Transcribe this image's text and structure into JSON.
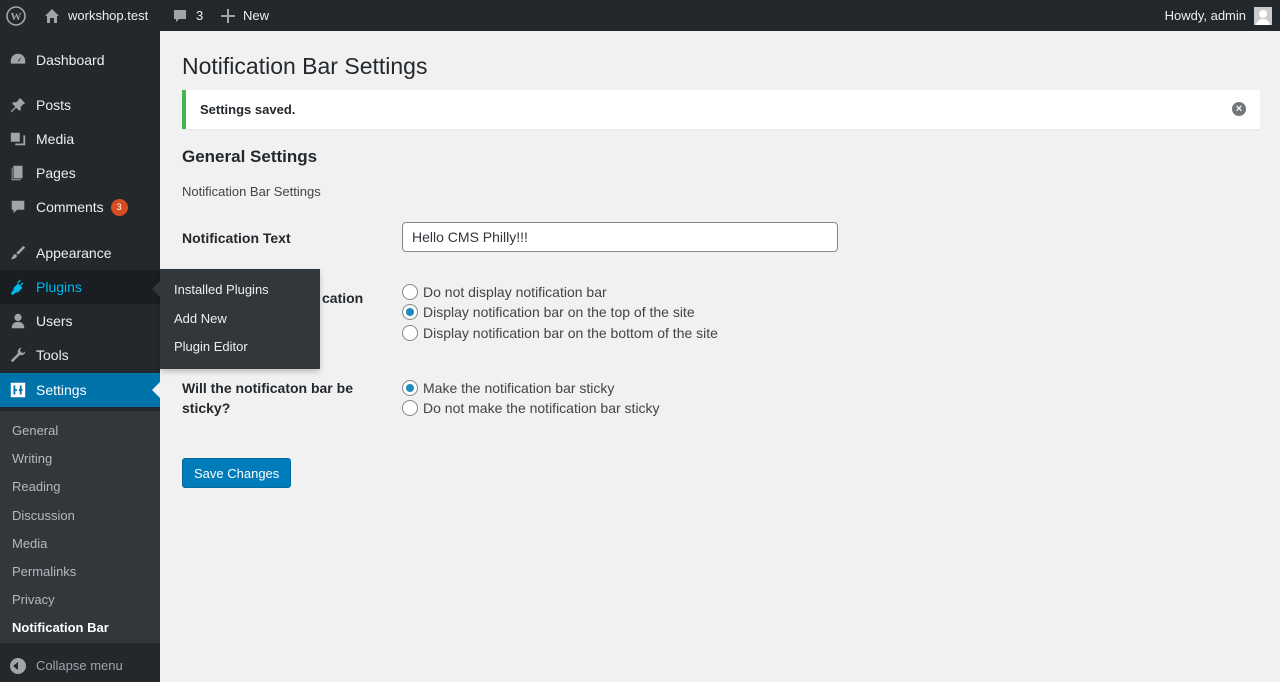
{
  "adminbar": {
    "site_name": "workshop.test",
    "comments_count": "3",
    "new_label": "New",
    "howdy": "Howdy, admin"
  },
  "sidebar": {
    "items": [
      {
        "label": "Dashboard",
        "icon": "dashboard-icon"
      },
      {
        "label": "Posts",
        "icon": "pin-icon"
      },
      {
        "label": "Media",
        "icon": "media-icon"
      },
      {
        "label": "Pages",
        "icon": "pages-icon"
      },
      {
        "label": "Comments",
        "icon": "comment-icon",
        "badge": "3"
      },
      {
        "label": "Appearance",
        "icon": "brush-icon"
      },
      {
        "label": "Plugins",
        "icon": "plug-icon"
      },
      {
        "label": "Users",
        "icon": "user-icon"
      },
      {
        "label": "Tools",
        "icon": "wrench-icon"
      },
      {
        "label": "Settings",
        "icon": "settings-icon"
      }
    ],
    "settings_submenu": [
      "General",
      "Writing",
      "Reading",
      "Discussion",
      "Media",
      "Permalinks",
      "Privacy",
      "Notification Bar"
    ],
    "collapse_label": "Collapse menu"
  },
  "plugins_flyout": [
    "Installed Plugins",
    "Add New",
    "Plugin Editor"
  ],
  "main": {
    "page_title": "Notification Bar Settings",
    "notice": "Settings saved.",
    "section_title": "General Settings",
    "section_desc": "Notification Bar Settings",
    "text_label": "Notification Text",
    "text_value": "Hello CMS Philly!!!",
    "position_label_visible": "cation",
    "position_options": [
      {
        "label": "Do not display notification bar",
        "checked": false
      },
      {
        "label": "Display notification bar on the top of the site",
        "checked": true
      },
      {
        "label": "Display notification bar on the bottom of the site",
        "checked": false
      }
    ],
    "sticky_label_line1": "Will the notificaton bar be",
    "sticky_label_line2": "sticky?",
    "sticky_options": [
      {
        "label": "Make the notification bar sticky",
        "checked": true
      },
      {
        "label": "Do not make the notification bar sticky",
        "checked": false
      }
    ],
    "save_label": "Save Changes"
  },
  "colors": {
    "adminbar_bg": "#23282d",
    "accent": "#0073aa",
    "success": "#46b450",
    "badge": "#d54e21"
  }
}
